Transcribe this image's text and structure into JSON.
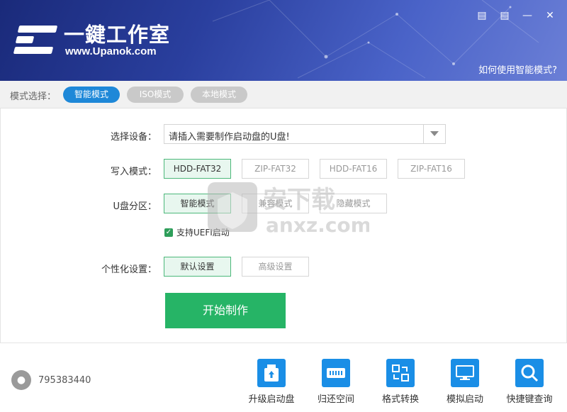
{
  "header": {
    "logo_title": "一鍵工作室",
    "logo_url": "www.Upanok.com",
    "help_link": "如何使用智能模式?",
    "icons": [
      "book-icon",
      "message-icon",
      "minimize-icon",
      "close-icon"
    ]
  },
  "mode_bar": {
    "label": "模式选择：",
    "modes": [
      {
        "label": "智能模式",
        "active": true
      },
      {
        "label": "ISO模式",
        "active": false
      },
      {
        "label": "本地模式",
        "active": false
      }
    ],
    "accent_color": "#1e88d8"
  },
  "form": {
    "device_label": "选择设备：",
    "device_value": "请插入需要制作启动盘的U盘!",
    "write_mode_label": "写入模式：",
    "write_modes": [
      "HDD-FAT32",
      "ZIP-FAT32",
      "HDD-FAT16",
      "ZIP-FAT16"
    ],
    "write_mode_selected": "HDD-FAT32",
    "partition_label": "U盘分区：",
    "partitions": [
      "智能模式",
      "兼容模式",
      "隐藏模式"
    ],
    "partition_selected": "智能模式",
    "uefi_label": "支持UEFI启动",
    "uefi_checked": true,
    "personal_label": "个性化设置：",
    "personal_options": [
      "默认设置",
      "高级设置"
    ],
    "personal_selected": "默认设置",
    "start_button": "开始制作",
    "start_color": "#26b466"
  },
  "watermark": {
    "text": "anxz.com"
  },
  "footer": {
    "qq_number": "795383440",
    "tools": [
      {
        "label": "升级启动盘",
        "icon": "upgrade-drive-icon"
      },
      {
        "label": "归还空间",
        "icon": "storage-icon"
      },
      {
        "label": "格式转换",
        "icon": "convert-icon"
      },
      {
        "label": "模拟启动",
        "icon": "monitor-icon"
      },
      {
        "label": "快捷键查询",
        "icon": "search-icon"
      }
    ]
  }
}
